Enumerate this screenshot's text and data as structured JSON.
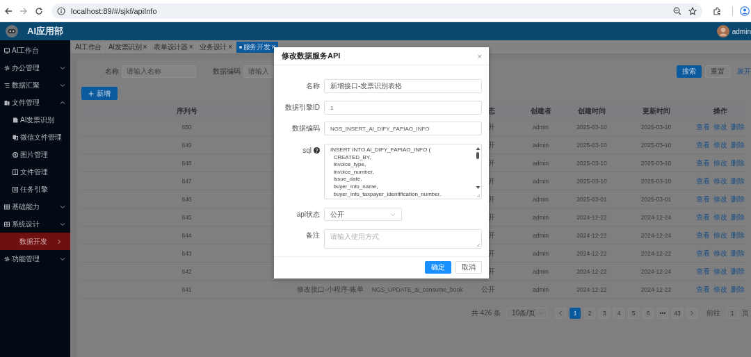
{
  "browser": {
    "url": "localhost:89/#/sjkf/apiInfo"
  },
  "header": {
    "title": "AI应用部",
    "user": "admin"
  },
  "sidebar": {
    "items": [
      {
        "kind": "entry",
        "label": "AI工作台",
        "selected": false
      },
      {
        "kind": "group",
        "label": "办公管理",
        "selected": false,
        "expanded": false
      },
      {
        "kind": "group",
        "label": "数据汇聚",
        "selected": false,
        "expanded": false
      },
      {
        "kind": "group",
        "label": "文件管理",
        "selected": false,
        "expanded": true,
        "children": [
          {
            "label": "AI发票识别",
            "selected": false
          },
          {
            "label": "微信文件管理",
            "selected": false
          },
          {
            "label": "图片管理",
            "selected": false
          },
          {
            "label": "文件管理",
            "selected": false
          },
          {
            "label": "任务引擎",
            "selected": false
          }
        ]
      },
      {
        "kind": "group",
        "label": "基础能力",
        "selected": false,
        "expanded": false
      },
      {
        "kind": "group",
        "label": "系统设计",
        "selected": false,
        "expanded": false
      },
      {
        "kind": "sub",
        "label": "数据开发",
        "selected": true
      },
      {
        "kind": "group",
        "label": "功能管理",
        "selected": false,
        "expanded": false
      }
    ]
  },
  "tabs": [
    {
      "label": "AI工作台",
      "selected": false
    },
    {
      "label": "AI发票识别",
      "close": "×",
      "selected": false
    },
    {
      "label": "表单设计器",
      "close": "×",
      "selected": false
    },
    {
      "label": "业务设计",
      "close": "×",
      "selected": false
    },
    {
      "label": "服务开发",
      "close": "×",
      "selected": true
    }
  ],
  "filters": [
    {
      "label": "名称",
      "placeholder": "请输入名称"
    },
    {
      "label": "数据编码",
      "placeholder": "请输入"
    }
  ],
  "filter_actions": {
    "search": "搜索",
    "reset": "重置",
    "expand": "展开"
  },
  "add_button": "新增",
  "table": {
    "header": {
      "seq": "序列号",
      "status": "态",
      "creator": "创建者",
      "created": "创建时间",
      "updated": "更新时间",
      "actions": "操作"
    },
    "rows": [
      {
        "seq": "650",
        "status": "开",
        "creator": "admin",
        "created": "2025-03-10",
        "updated": "2025-03-10",
        "actions": [
          "查看",
          "修改",
          "删除"
        ]
      },
      {
        "seq": "649",
        "status": "开",
        "creator": "admin",
        "created": "2025-03-10",
        "updated": "2025-03-10",
        "actions": [
          "查看",
          "修改",
          "删除"
        ]
      },
      {
        "seq": "648",
        "status": "开",
        "creator": "admin",
        "created": "2025-03-10",
        "updated": "2025-03-10",
        "actions": [
          "查看",
          "修改",
          "删除"
        ]
      },
      {
        "seq": "647",
        "status": "开",
        "creator": "admin",
        "created": "2025-03-10",
        "updated": "2025-03-10",
        "actions": [
          "查看",
          "修改",
          "删除"
        ]
      },
      {
        "seq": "646",
        "status": "开",
        "creator": "admin",
        "created": "2025-03-01",
        "updated": "2025-03-01",
        "actions": [
          "查看",
          "修改",
          "删除"
        ]
      },
      {
        "seq": "645",
        "status": "开",
        "creator": "admin",
        "created": "2024-12-22",
        "updated": "2024-12-24",
        "actions": [
          "查看",
          "修改",
          "删除"
        ]
      },
      {
        "seq": "644",
        "status": "开",
        "creator": "admin",
        "created": "2024-12-22",
        "updated": "2024-12-24",
        "actions": [
          "查看",
          "修改",
          "删除"
        ]
      },
      {
        "seq": "643",
        "status": "开",
        "creator": "admin",
        "created": "2024-12-22",
        "updated": "2024-12-22",
        "actions": [
          "查看",
          "修改",
          "删除"
        ]
      },
      {
        "seq": "642",
        "status": "开",
        "creator": "admin",
        "created": "2024-12-22",
        "updated": "2024-12-24",
        "actions": [
          "查看",
          "修改",
          "删除"
        ]
      },
      {
        "seq": "641",
        "name": "修改接口-小程序-账单",
        "code": "NGS_UPDATE_ai_consume_book",
        "status": "公开",
        "creator": "admin",
        "created": "2024-12-22",
        "updated": "2024-12-22",
        "actions": [
          "查看",
          "修改",
          "删除"
        ]
      }
    ]
  },
  "pagination": {
    "total": "共 426 条",
    "page_size": "10条/页",
    "pages": [
      {
        "label": "1",
        "selected": true
      },
      {
        "label": "2",
        "selected": false
      },
      {
        "label": "3",
        "selected": false
      },
      {
        "label": "4",
        "selected": false
      },
      {
        "label": "5",
        "selected": false
      },
      {
        "label": "6",
        "selected": false
      },
      {
        "label": "•••",
        "selected": false
      },
      {
        "label": "43",
        "selected": false
      }
    ],
    "goto_label": "前往",
    "goto_value": "1",
    "goto_suffix": "页"
  },
  "dialog": {
    "title": "修改数据服务API",
    "close": "×",
    "fields": [
      {
        "kind": "input",
        "label": "名称",
        "value": "新增接口-发票识别表格"
      },
      {
        "kind": "input",
        "label": "数据引擎ID",
        "value": "1"
      },
      {
        "kind": "input",
        "label": "数据编码",
        "value": "NGS_INSERT_AI_DIFY_FAPIAO_INFO"
      },
      {
        "kind": "code",
        "label": "sql",
        "help": true,
        "lines": [
          "INSERT INTO AI_DIFY_FAPIAO_INFO (",
          "  CREATED_BY,",
          "  invoice_type,",
          "  invoice_number,",
          "  issue_date,",
          "  buyer_info_name,",
          "  buyer_info_taxpayer_identification_number,"
        ]
      },
      {
        "kind": "select",
        "label": "api状态",
        "value": "公开"
      },
      {
        "kind": "textarea",
        "label": "备注",
        "placeholder": "请输入使用方式"
      }
    ],
    "buttons": [
      {
        "label": "确定",
        "primary": true
      },
      {
        "label": "取消",
        "primary": false
      }
    ]
  }
}
